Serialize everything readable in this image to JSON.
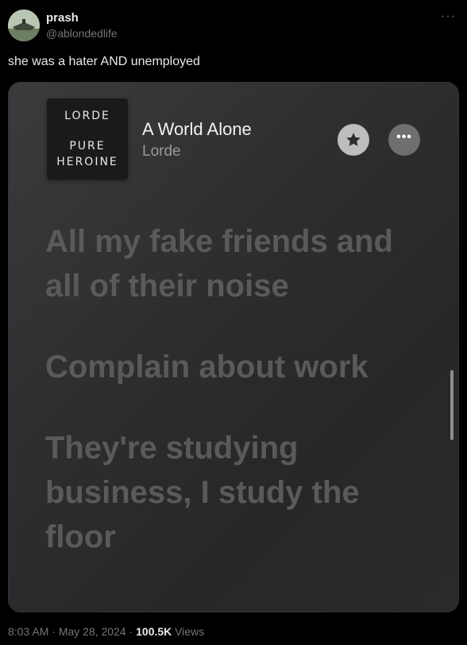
{
  "tweet": {
    "display_name": "prash",
    "handle": "@ablondedlife",
    "text": "she was a hater AND unemployed",
    "more_label": "···",
    "meta": {
      "time": "8:03 AM",
      "sep1": " · ",
      "date": "May 28, 2024",
      "sep2": " · ",
      "views_count": "100.5K",
      "views_label": " Views"
    }
  },
  "now_playing": {
    "album_line1": "LORDE",
    "album_line2": "PURE",
    "album_line3": "HEROINE",
    "title": "A World Alone",
    "artist": "Lorde",
    "more_label": "•••",
    "lyrics": [
      "All my fake friends and all of their noise",
      "Complain about work",
      "They're studying business, I study the floor"
    ]
  },
  "icons": {
    "favorite": "star-icon",
    "more": "ellipsis-icon"
  }
}
